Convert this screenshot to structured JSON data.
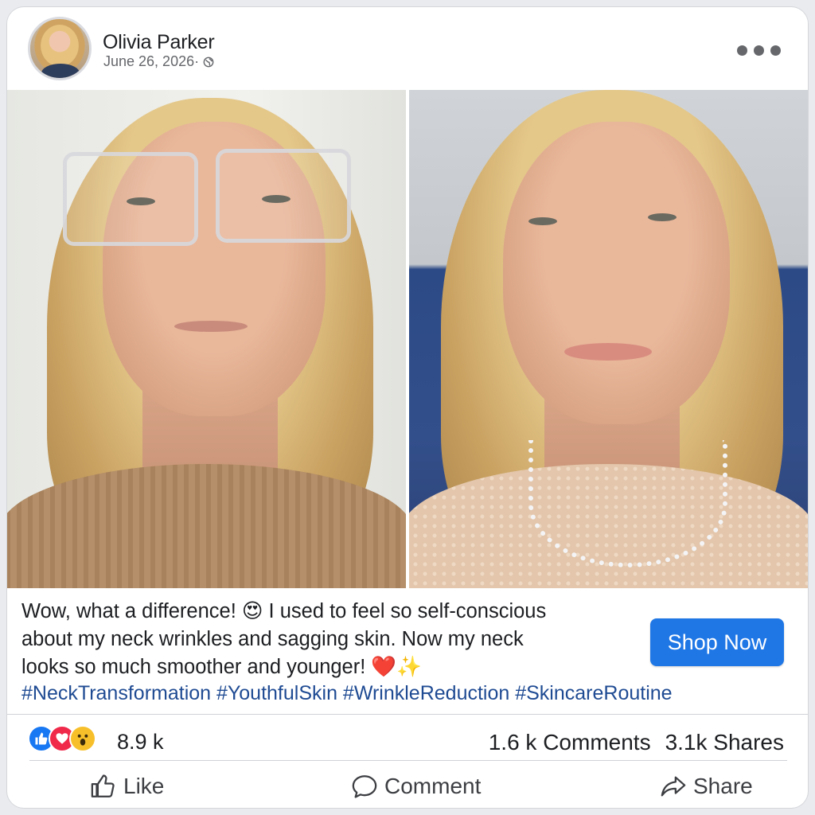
{
  "post": {
    "author": "Olivia Parker",
    "date": "June 26, 2026·",
    "caption_lines": [
      "Wow, what a difference! 😍 I used to feel so self-conscious",
      "about my neck wrinkles and sagging skin. Now my neck",
      "looks so much smoother and younger! ❤️✨"
    ],
    "hashtags": "#NeckTransformation #YouthfulSkin #WrinkleReduction #SkincareRoutine",
    "cta_label": "Shop Now"
  },
  "stats": {
    "reaction_count": "8.9 k",
    "comments": "1.6 k Comments",
    "shares": "3.1k Shares"
  },
  "actions": {
    "like": "Like",
    "comment": "Comment",
    "share": "Share"
  },
  "icons": [
    "globe-icon",
    "more-options-icon",
    "like-reaction-icon",
    "love-reaction-icon",
    "wow-reaction-icon",
    "thumbs-up-icon",
    "comment-icon",
    "share-icon"
  ],
  "colors": {
    "link": "#1f4b93",
    "cta": "#1f77e6",
    "like": "#1877f2",
    "love": "#f0284a"
  }
}
